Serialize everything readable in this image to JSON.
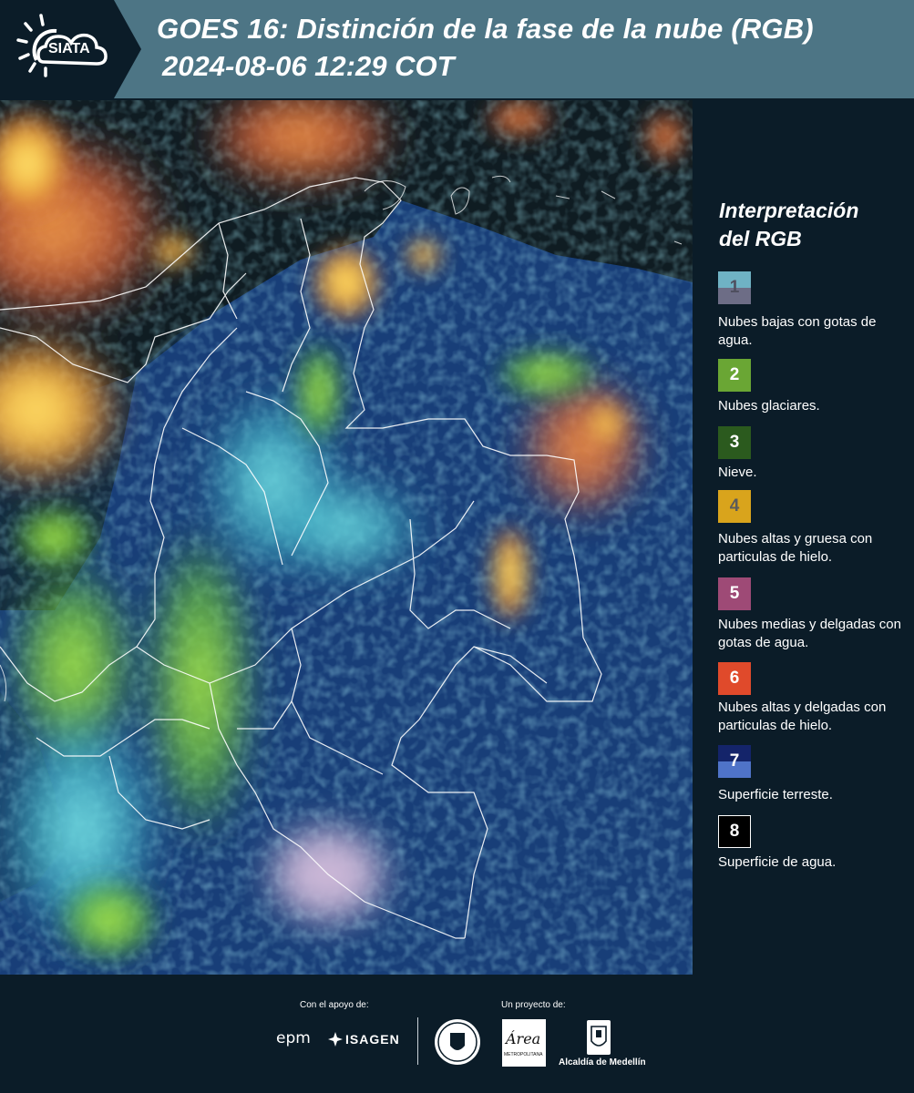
{
  "header": {
    "logo_text": "SIATA",
    "title": "GOES 16: Distinción de la fase de la nube (RGB)",
    "subtitle": "2024-08-06 12:29 COT"
  },
  "legend": {
    "title": "Interpretación\ndel RGB",
    "items": [
      {
        "num": "1",
        "label": "Nubes bajas con gotas de agua.",
        "colors": [
          "#6fb2c4",
          "#6d6d86"
        ],
        "num_color": "#5b5b6b"
      },
      {
        "num": "2",
        "label": "Nubes glaciares.",
        "colors": [
          "#6aa634"
        ],
        "num_color": "#ffffff"
      },
      {
        "num": "3",
        "label": "Nieve.",
        "colors": [
          "#2b5a1e"
        ],
        "num_color": "#ffffff"
      },
      {
        "num": "4",
        "label": "Nubes altas y gruesa con particulas de hielo.",
        "colors": [
          "#d9a41c"
        ],
        "num_color": "#5b5b5b"
      },
      {
        "num": "5",
        "label": "Nubes medias y delgadas con gotas de agua.",
        "colors": [
          "#9e4a76"
        ],
        "num_color": "#ffffff"
      },
      {
        "num": "6",
        "label": "Nubes altas y delgadas con particulas de hielo.",
        "colors": [
          "#e04a2b"
        ],
        "num_color": "#ffffff"
      },
      {
        "num": "7",
        "label": "Superficie terreste.",
        "colors": [
          "#14246a",
          "#4f73c8"
        ],
        "num_color": "#ffffff"
      },
      {
        "num": "8",
        "label": "Superficie de agua.",
        "colors": [
          "#000000"
        ],
        "num_color": "#ffffff"
      }
    ]
  },
  "footer": {
    "support_label": "Con el apoyo de:",
    "project_label": "Un proyecto de:",
    "sponsors": [
      "epm",
      "ISAGEN"
    ],
    "area_logo_text": "Área",
    "area_logo_sub": "METROPOLITANA",
    "alcaldia_label": "Alcaldía de Medellín"
  }
}
